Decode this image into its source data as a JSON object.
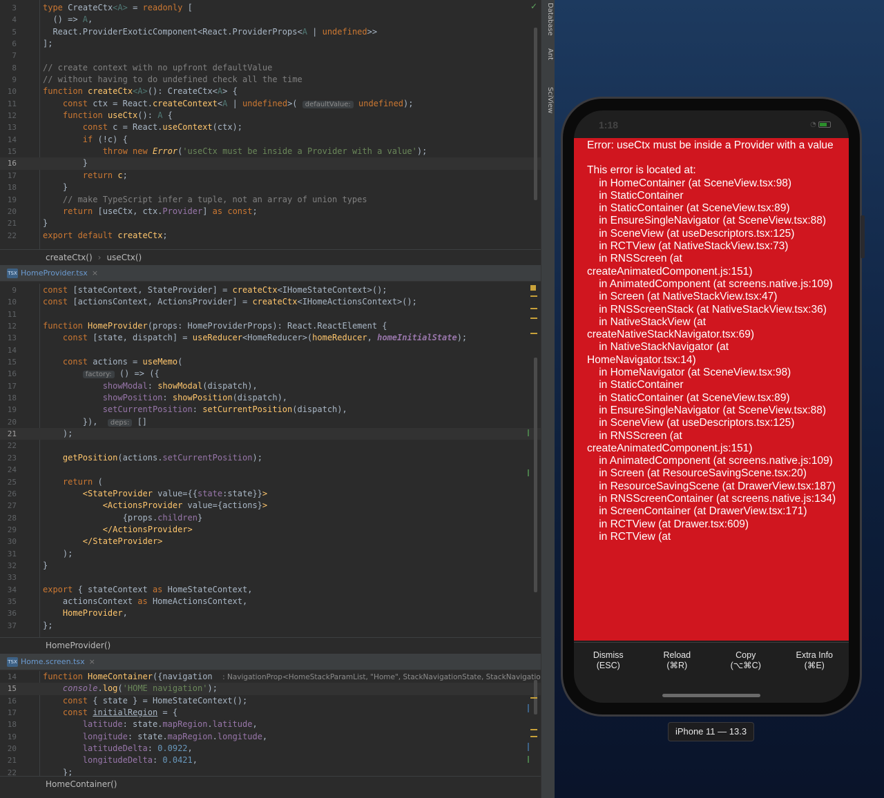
{
  "ide": {
    "panes": [
      {
        "crumbs": [
          "createCtx()",
          "useCtx()"
        ],
        "lines": [
          {
            "n": "3",
            "h": "<span class='kw'>type</span> <span class='tp'>CreateCtx</span><span class='gen'>&lt;A&gt;</span> = <span class='kw'>readonly</span> ["
          },
          {
            "n": "4",
            "h": "  () =&gt; <span class='gen'>A</span>,"
          },
          {
            "n": "5",
            "h": "  React.ProviderExoticComponent&lt;React.ProviderProps&lt;<span class='gen'>A</span> | <span class='kw'>undefined</span>&gt;&gt;"
          },
          {
            "n": "6",
            "h": "];"
          },
          {
            "n": "7",
            "h": ""
          },
          {
            "n": "8",
            "h": "<span class='cm'>// create context with no upfront defaultValue</span>"
          },
          {
            "n": "9",
            "h": "<span class='cm'>// without having to do undefined check all the time</span>"
          },
          {
            "n": "10",
            "h": "<span class='kw'>function</span> <span class='fn'>createCtx</span><span class='gen'>&lt;A&gt;</span>(): CreateCtx&lt;<span class='gen'>A</span>&gt; {"
          },
          {
            "n": "11",
            "h": "    <span class='kw'>const</span> ctx = React.<span class='fn'>createContext</span>&lt;<span class='gen'>A</span> | <span class='kw'>undefined</span>&gt;( <span class='hint'>defaultValue:</span> <span class='kw'>undefined</span>);"
          },
          {
            "n": "12",
            "h": "    <span class='kw'>function</span> <span class='fn'>useCtx</span>(): <span class='gen'>A</span> {"
          },
          {
            "n": "13",
            "h": "        <span class='kw'>const</span> c = React.<span class='fn'>useContext</span>(ctx);"
          },
          {
            "n": "14",
            "h": "        <span class='kw'>if</span> (!c) {"
          },
          {
            "n": "15",
            "h": "            <span class='kw'>throw new</span> <span class='fn it'>Error</span>(<span class='str'>'useCtx must be inside a Provider with a value'</span>);"
          },
          {
            "n": "16",
            "h": "        }",
            "cur": true
          },
          {
            "n": "17",
            "h": "        <span class='kw'>return</span> <span class='fn'>c</span>;"
          },
          {
            "n": "18",
            "h": "    }"
          },
          {
            "n": "19",
            "h": "    <span class='cm'>// make TypeScript infer a tuple, not an array of union types</span>"
          },
          {
            "n": "20",
            "h": "    <span class='kw'>return</span> [useCtx, ctx.<span class='prop'>Provider</span>] <span class='kw'>as const</span>;"
          },
          {
            "n": "21",
            "h": "}"
          },
          {
            "n": "22",
            "h": "<span class='kw'>export default</span> <span class='fn'>createCtx</span>;"
          }
        ]
      },
      {
        "tab": "HomeProvider.tsx",
        "crumbs": [
          "HomeProvider()"
        ],
        "lines": [
          {
            "n": "9",
            "h": "<span class='kw'>const</span> [stateContext, StateProvider] = <span class='fn'>createCtx</span>&lt;IHomeStateContext&gt;();"
          },
          {
            "n": "10",
            "h": "<span class='kw'>const</span> [actionsContext, ActionsProvider] = <span class='fn'>createCtx</span>&lt;IHomeActionsContext&gt;();"
          },
          {
            "n": "11",
            "h": ""
          },
          {
            "n": "12",
            "h": "<span class='kw'>function</span> <span class='fn'>HomeProvider</span>(props: HomeProviderProps): React.ReactElement {"
          },
          {
            "n": "13",
            "h": "    <span class='kw'>const</span> [state, dispatch] = <span class='fn'>useReducer</span>&lt;HomeReducer&gt;(<span class='fn'>homeReducer</span>, <span class='bit'>homeInitialState</span>);"
          },
          {
            "n": "14",
            "h": ""
          },
          {
            "n": "15",
            "h": "    <span class='kw'>const</span> actions = <span class='fn'>useMemo</span>("
          },
          {
            "n": "16",
            "h": "        <span class='hint'>factory:</span> () =&gt; ({"
          },
          {
            "n": "17",
            "h": "            <span class='prop'>showModal</span>: <span class='fn'>showModal</span>(dispatch),"
          },
          {
            "n": "18",
            "h": "            <span class='prop'>showPosition</span>: <span class='fn'>showPosition</span>(dispatch),"
          },
          {
            "n": "19",
            "h": "            <span class='prop'>setCurrentPosition</span>: <span class='fn'>setCurrentPosition</span>(dispatch),"
          },
          {
            "n": "20",
            "h": "        }),  <span class='hint'>deps:</span> []"
          },
          {
            "n": "21",
            "h": "    );",
            "cur": true
          },
          {
            "n": "22",
            "h": ""
          },
          {
            "n": "23",
            "h": "    <span class='fn'>getPosition</span>(actions.<span class='prop'>setCurrentPosition</span>);"
          },
          {
            "n": "24",
            "h": ""
          },
          {
            "n": "25",
            "h": "    <span class='kw'>return</span> ("
          },
          {
            "n": "26",
            "h": "        <span class='fn'>&lt;StateProvider</span> value={{<span class='prop'>state</span>:state}}<span class='fn'>&gt;</span>"
          },
          {
            "n": "27",
            "h": "            <span class='fn'>&lt;ActionsProvider</span> value={actions}<span class='fn'>&gt;</span>"
          },
          {
            "n": "28",
            "h": "                {props.<span class='prop'>children</span>}"
          },
          {
            "n": "29",
            "h": "            <span class='fn'>&lt;/ActionsProvider&gt;</span>"
          },
          {
            "n": "30",
            "h": "        <span class='fn'>&lt;/StateProvider&gt;</span>"
          },
          {
            "n": "31",
            "h": "    );"
          },
          {
            "n": "32",
            "h": "}"
          },
          {
            "n": "33",
            "h": ""
          },
          {
            "n": "34",
            "h": "<span class='kw'>export</span> { stateContext <span class='kw'>as</span> HomeStateContext,"
          },
          {
            "n": "35",
            "h": "    actionsContext <span class='kw'>as</span> HomeActionsContext,"
          },
          {
            "n": "36",
            "h": "    <span class='fn'>HomeProvider</span>,"
          },
          {
            "n": "37",
            "h": "};"
          }
        ]
      },
      {
        "tab": "Home.screen.tsx",
        "crumbs": [
          "HomeContainer()"
        ],
        "lines": [
          {
            "n": "14",
            "h": "<span class='kw'>function</span> <span class='fn'>HomeContainer</span>({navigation  <span class='hint2'>: NavigationProp&lt;HomeStackParamList, \"Home\", StackNavigationState, StackNavigationOptions, St</span>"
          },
          {
            "n": "15",
            "h": "    <span class='prop it'>console</span>.<span class='fn'>log</span>(<span class='str'>'HOME navigation'</span>);",
            "cur": true
          },
          {
            "n": "16",
            "h": "    <span class='kw'>const</span> { state } = HomeStateContext();"
          },
          {
            "n": "17",
            "h": "    <span class='kw'>const</span> <u>initialRegion</u> = {"
          },
          {
            "n": "18",
            "h": "        <span class='prop'>latitude</span>: state.<span class='prop'>mapRegion</span>.<span class='prop'>latitude</span>,"
          },
          {
            "n": "19",
            "h": "        <span class='prop'>longitude</span>: state.<span class='prop'>mapRegion</span>.<span class='prop'>longitude</span>,"
          },
          {
            "n": "20",
            "h": "        <span class='prop'>latitudeDelta</span>: <span class='num'>0.0922</span>,"
          },
          {
            "n": "21",
            "h": "        <span class='prop'>longitudeDelta</span>: <span class='num'>0.0421</span>,"
          },
          {
            "n": "22",
            "h": "    };"
          }
        ]
      }
    ],
    "side_tabs": [
      "Database",
      "Ant",
      "SciView"
    ]
  },
  "simulator": {
    "time": "1:18",
    "error_message": "Error: useCtx must be inside a Provider with a value",
    "trace_header": "This error is located at:",
    "trace": [
      "    in HomeContainer (at SceneView.tsx:98)",
      "    in StaticContainer",
      "    in StaticContainer (at SceneView.tsx:89)",
      "    in EnsureSingleNavigator (at SceneView.tsx:88)",
      "    in SceneView (at useDescriptors.tsx:125)",
      "    in RCTView (at NativeStackView.tsx:73)",
      "    in RNSScreen (at createAnimatedComponent.js:151)",
      "    in AnimatedComponent (at screens.native.js:109)",
      "    in Screen (at NativeStackView.tsx:47)",
      "    in RNSScreenStack (at NativeStackView.tsx:36)",
      "    in NativeStackView (at createNativeStackNavigator.tsx:69)",
      "    in NativeStackNavigator (at HomeNavigator.tsx:14)",
      "    in HomeNavigator (at SceneView.tsx:98)",
      "    in StaticContainer",
      "    in StaticContainer (at SceneView.tsx:89)",
      "    in EnsureSingleNavigator (at SceneView.tsx:88)",
      "    in SceneView (at useDescriptors.tsx:125)",
      "    in RNSScreen (at createAnimatedComponent.js:151)",
      "    in AnimatedComponent (at screens.native.js:109)",
      "    in Screen (at ResourceSavingScene.tsx:20)",
      "    in ResourceSavingScene (at DrawerView.tsx:187)",
      "    in RNSScreenContainer (at screens.native.js:134)",
      "    in ScreenContainer (at DrawerView.tsx:171)",
      "    in RCTView (at Drawer.tsx:609)",
      "    in RCTView (at"
    ],
    "actions": [
      {
        "label": "Dismiss",
        "shortcut": "(ESC)"
      },
      {
        "label": "Reload",
        "shortcut": "(⌘R)"
      },
      {
        "label": "Copy",
        "shortcut": "(⌥⌘C)"
      },
      {
        "label": "Extra Info",
        "shortcut": "(⌘E)"
      }
    ],
    "device_label": "iPhone 11 — 13.3"
  }
}
